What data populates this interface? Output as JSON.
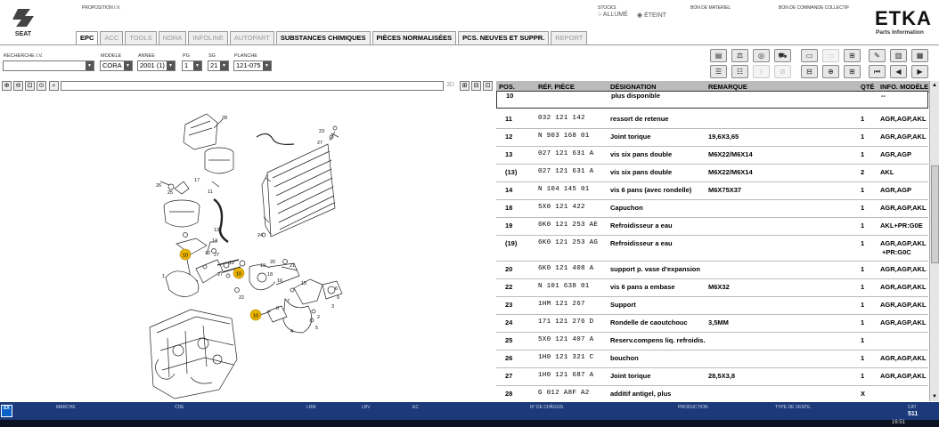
{
  "brand": {
    "name": "SEAT",
    "app": "ETKA",
    "app_sub": "Parts Information"
  },
  "top": {
    "proposition_label": "PROPOSITION I.V.",
    "stocks_label": "STOCKS",
    "stock_on": "ALLUMÉ",
    "stock_off": "ÉTEINT",
    "bon_materiel": "BON DE MATERIEL",
    "bon_commande": "BON DE COMMANDE COLLECTIF"
  },
  "tabs": [
    {
      "label": "EPC",
      "state": "on"
    },
    {
      "label": "ACC",
      "state": "off"
    },
    {
      "label": "TOOLS",
      "state": "off"
    },
    {
      "label": "NORA",
      "state": "off"
    },
    {
      "label": "INFOLINE",
      "state": "off"
    },
    {
      "label": "AUTOPART",
      "state": "off"
    },
    {
      "label": "SUBSTANCES CHIMIQUES",
      "state": "act"
    },
    {
      "label": "PIÈCES NORMALISÉES",
      "state": "act"
    },
    {
      "label": "PCS. NEUVES ET SUPPR.",
      "state": "act"
    },
    {
      "label": "REPORT",
      "state": "off"
    }
  ],
  "filters": {
    "recherche_label": "RECHERCHE I.V.",
    "recherche_value": "",
    "modele_label": "MODELE",
    "modele_value": "CORA",
    "annee_label": "ANNEE",
    "annee_value": "2001 (1)",
    "pg_label": "PG",
    "pg_value": "1",
    "sg_label": "SG",
    "sg_value": "21",
    "planche_label": "PLANCHE",
    "planche_value": "121-075"
  },
  "zoom": {
    "label_3d": "3D"
  },
  "diagram": {
    "callouts": [
      "10",
      "10",
      "10"
    ],
    "numbers": [
      "28",
      "23",
      "27",
      "26",
      "25",
      "17",
      "11",
      "13",
      "14",
      "24",
      "12",
      "12",
      "1",
      "27",
      "27",
      "19",
      "20",
      "21",
      "18",
      "16",
      "15",
      "6",
      "9",
      "3",
      "2",
      "5",
      "22",
      "7",
      "8",
      "4"
    ]
  },
  "table": {
    "headers": {
      "pos": "POS.",
      "ref": "RÉF. PIÈCE",
      "des": "DÉSIGNATION",
      "rem": "REMARQUE",
      "qty": "QTÉ",
      "info": "INFO. MODÈLE"
    },
    "rows": [
      {
        "pos": "10",
        "ref": "",
        "des": "plus disponible",
        "rem": "",
        "qty": "",
        "info": "--"
      },
      {
        "pos": "11",
        "ref": "032 121 142",
        "des": "ressort de retenue",
        "rem": "",
        "qty": "1",
        "info": "AGR,AGP,AKL"
      },
      {
        "pos": "12",
        "ref": "N   903 168 01",
        "des": "Joint torique",
        "rem": "19,6X3,65",
        "qty": "1",
        "info": "AGR,AGP,AKL"
      },
      {
        "pos": "13",
        "ref": "027 121 631 A",
        "des": "vis six pans double",
        "rem": "M6X22/M6X14",
        "qty": "1",
        "info": "AGR,AGP"
      },
      {
        "pos": "(13)",
        "ref": "027 121 631 A",
        "des": "vis six pans double",
        "rem": "M6X22/M6X14",
        "qty": "2",
        "info": "AKL"
      },
      {
        "pos": "14",
        "ref": "N   104 145 01",
        "des": "vis 6 pans (avec rondelle)",
        "rem": "M6X75X37",
        "qty": "1",
        "info": "AGR,AGP"
      },
      {
        "pos": "18",
        "ref": "5X0 121 422",
        "des": "Capuchon",
        "rem": "",
        "qty": "1",
        "info": "AGR,AGP,AKL"
      },
      {
        "pos": "19",
        "ref": "6K0 121 253 AE",
        "des": "Refroidisseur a eau",
        "rem": "",
        "qty": "1",
        "info": "AKL+PR:G0E"
      },
      {
        "pos": "(19)",
        "ref": "6K0 121 253 AG",
        "des": "Refroidisseur a eau",
        "rem": "",
        "qty": "1",
        "info": "AGR,AGP,AKL",
        "info2": "+PR:G0C"
      },
      {
        "pos": "20",
        "ref": "6K0 121 408 A",
        "des": "support p. vase d'expansion",
        "rem": "",
        "qty": "1",
        "info": "AGR,AGP,AKL"
      },
      {
        "pos": "22",
        "ref": "N   101 638 01",
        "des": "vis 6 pans a embase",
        "rem": "M6X32",
        "qty": "1",
        "info": "AGR,AGP,AKL"
      },
      {
        "pos": "23",
        "ref": "1HM 121 267",
        "des": "Support",
        "rem": "",
        "qty": "1",
        "info": "AGR,AGP,AKL"
      },
      {
        "pos": "24",
        "ref": "171 121 276 D",
        "des": "Rondelle de caoutchouc",
        "rem": "3,5MM",
        "qty": "1",
        "info": "AGR,AGP,AKL"
      },
      {
        "pos": "25",
        "ref": "5X0 121 407 A",
        "des": "Reserv.compens liq. refroidis.",
        "rem": "",
        "qty": "1",
        "info": ""
      },
      {
        "pos": "26",
        "ref": "1H0 121 321 C",
        "des": "bouchon",
        "rem": "",
        "qty": "1",
        "info": "AGR,AGP,AKL"
      },
      {
        "pos": "27",
        "ref": "1H0 121 687 A",
        "des": "Joint torique",
        "rem": "28,5X3,8",
        "qty": "1",
        "info": "AGR,AGP,AKL"
      },
      {
        "pos": "28",
        "ref": "G   012 A8F A2",
        "des": "additif antigel, plus",
        "rem": "",
        "qty": "X",
        "info": ""
      }
    ]
  },
  "status": {
    "marche": "MARCHE",
    "cde": "CDE",
    "lrm": "LRM",
    "lbv": "LBV",
    "ec": "EC",
    "chassis": "N° DE CHÂSSIS",
    "production": "PRODUCTION",
    "type_vente": "TYPE DE VENTE",
    "cat_label": "CAT",
    "cat_value": "511",
    "logo": "EX"
  },
  "taskbar": {
    "clock": "16:51"
  },
  "colors": {
    "status_bg": "#1c3a7a",
    "callout": "#e8b200"
  }
}
